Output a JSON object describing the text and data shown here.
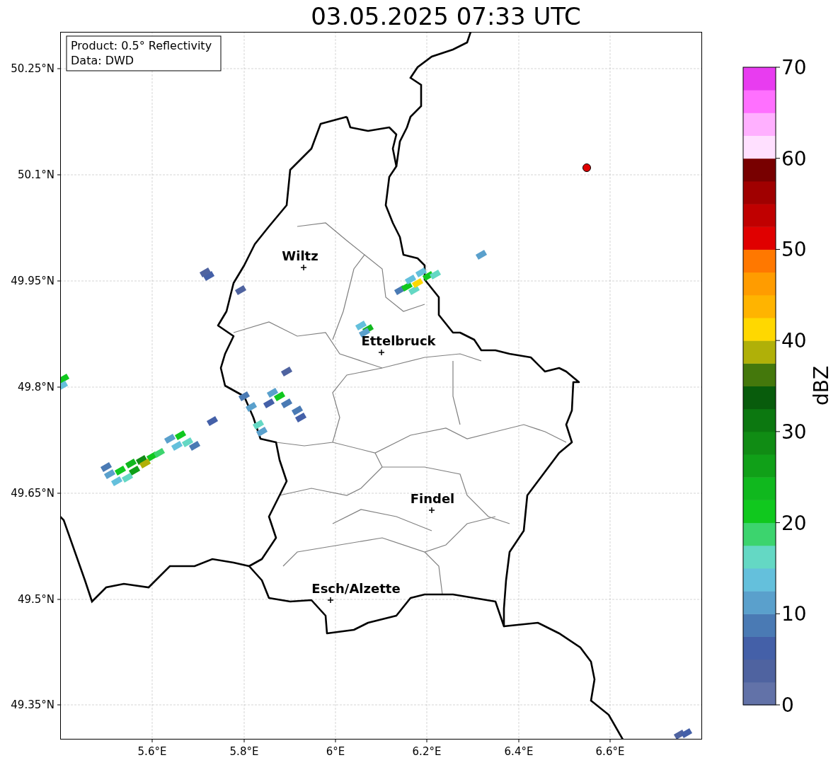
{
  "title": "03.05.2025 07:33 UTC",
  "info_box": {
    "lines": [
      "Product: 0.5° Reflectivity",
      "Data: DWD"
    ]
  },
  "map": {
    "cities": [
      {
        "label": "Wiltz"
      },
      {
        "label": "Ettelbruck"
      },
      {
        "label": "Findel"
      },
      {
        "label": "Esch/Alzette"
      }
    ],
    "x_ticks": [
      "5.6°E",
      "5.8°E",
      "6°E",
      "6.2°E",
      "6.4°E",
      "6.6°E"
    ],
    "y_ticks": [
      "50.25°N",
      "50.1°N",
      "49.95°N",
      "49.8°N",
      "49.65°N",
      "49.5°N",
      "49.35°N"
    ]
  },
  "colorbar": {
    "label": "dBZ",
    "ticks": [
      "70",
      "60",
      "50",
      "40",
      "30",
      "20",
      "10",
      "0"
    ],
    "bands": [
      {
        "color": "#6272a8"
      },
      {
        "color": "#4f63a0"
      },
      {
        "color": "#4460a8"
      },
      {
        "color": "#4a7ab4"
      },
      {
        "color": "#5aa0cc"
      },
      {
        "color": "#64c0dc"
      },
      {
        "color": "#64d8c4"
      },
      {
        "color": "#3cd46e"
      },
      {
        "color": "#10c81e"
      },
      {
        "color": "#10b81e"
      },
      {
        "color": "#10a018"
      },
      {
        "color": "#108c14"
      },
      {
        "color": "#0c7810"
      },
      {
        "color": "#085c0c"
      },
      {
        "color": "#44780c"
      },
      {
        "color": "#b0b008"
      },
      {
        "color": "#ffd800"
      },
      {
        "color": "#ffb400"
      },
      {
        "color": "#ff9c00"
      },
      {
        "color": "#ff7800"
      },
      {
        "color": "#e00000"
      },
      {
        "color": "#c00000"
      },
      {
        "color": "#a00000"
      },
      {
        "color": "#780000"
      },
      {
        "color": "#ffe0ff"
      },
      {
        "color": "#ffb0ff"
      },
      {
        "color": "#ff70ff"
      },
      {
        "color": "#e83cf0"
      }
    ]
  }
}
